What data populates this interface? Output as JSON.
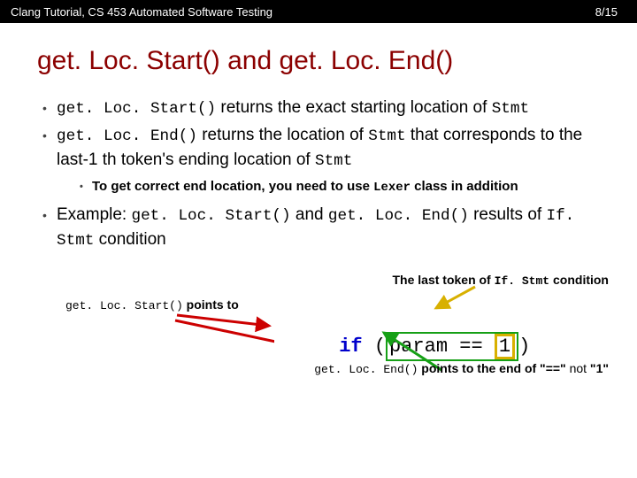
{
  "header": {
    "course": "Clang Tutorial, CS 453 Automated Software Testing",
    "page_current": "8",
    "page_total": "/15"
  },
  "title": {
    "p1": "get. Loc. Start()",
    "mid": " and ",
    "p2": "get. Loc. End()"
  },
  "bullets": {
    "b1_code": "get. Loc. Start()",
    "b1_rest": " returns the exact starting location of ",
    "b1_stmt": "Stmt",
    "b2_code": "get. Loc. End()",
    "b2_mid1": " returns the location of ",
    "b2_stmt": "Stmt",
    "b2_mid2": " that corresponds to the last-1 th token's ending location of ",
    "b2_stmt2": "Stmt",
    "sub_pre": "To get correct end location, you need to use ",
    "sub_code": "Lexer",
    "sub_post": " class in addition",
    "ex_pre": "Example: ",
    "ex_c1": "get. Loc. Start()",
    "ex_and": " and ",
    "ex_c2": "get. Loc. End()",
    "ex_mid": " results of ",
    "ex_ifs": "If. Stmt",
    "ex_post": " condition"
  },
  "diagram": {
    "start_label_code": "get. Loc. Start()",
    "start_label_rest": " points to",
    "last_pre": "The last token of ",
    "last_code": "If. Stmt",
    "last_post": " condition",
    "end_code": "get. Loc. End()",
    "end_mid": " points to ",
    "end_rest1": "the end of \"==\" ",
    "end_not": "not",
    "end_rest2": " \"1\"",
    "code_if": "if",
    "code_sp": " ",
    "code_lp": "(",
    "code_param": "param",
    "code_eq": " == ",
    "code_one": "1",
    "code_rp": ")"
  }
}
